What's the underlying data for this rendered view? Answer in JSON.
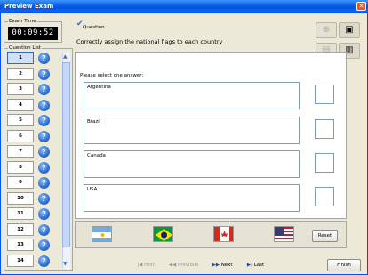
{
  "window": {
    "title": "Preview Exam",
    "close_glyph": "✕"
  },
  "exam_time": {
    "label": "Exam Time",
    "value": "00:09:52"
  },
  "question_list": {
    "label": "Question List",
    "items": [
      "1",
      "2",
      "3",
      "4",
      "5",
      "6",
      "7",
      "8",
      "9",
      "10",
      "11",
      "12",
      "13",
      "14"
    ],
    "active": "1",
    "help_glyph": "?"
  },
  "question": {
    "title": "Question",
    "text": "Correctly assign the national flags to each country",
    "prompt": "Please select one answer:"
  },
  "answers": [
    "Argentina",
    "Brazil",
    "Canada",
    "USA"
  ],
  "flags": [
    {
      "name": "argentina-flag-icon"
    },
    {
      "name": "brazil-flag-icon"
    },
    {
      "name": "canada-flag-icon"
    },
    {
      "name": "usa-flag-icon"
    }
  ],
  "buttons": {
    "reset": "Reset",
    "first": "First",
    "previous": "Previous",
    "next": "Next",
    "last": "Last",
    "finish": "Finish"
  },
  "colors": {
    "titlebar": "#0054E3",
    "accent": "#316AC5",
    "timer_bg": "#000000"
  }
}
